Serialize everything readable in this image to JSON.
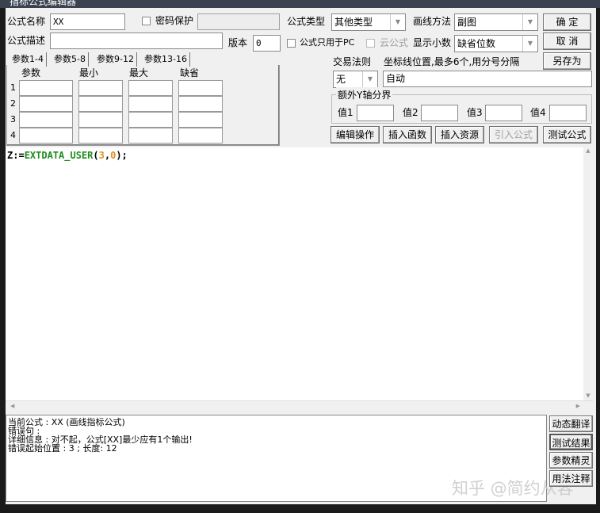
{
  "window": {
    "title": "指标公式编辑器"
  },
  "form": {
    "name_label": "公式名称",
    "name_value": "XX",
    "password_label": "密码保护",
    "desc_label": "公式描述",
    "desc_value": "",
    "version_label": "版本",
    "version_value": "0",
    "type_label": "公式类型",
    "type_value": "其他类型",
    "draw_label": "画线方法",
    "draw_value": "副图",
    "pc_only_label": "公式只用于PC",
    "cloud_label": "云公式",
    "decimal_label": "显示小数",
    "decimal_value": "缺省位数",
    "trade_label": "交易法则",
    "trade_value": "无",
    "axis_label": "坐标线位置,最多6个,用分号分隔",
    "axis_value": "自动",
    "yaxis_group": "额外Y轴分界",
    "yvals": [
      "值1",
      "值2",
      "值3",
      "值4"
    ]
  },
  "tabs": [
    "参数1-4",
    "参数5-8",
    "参数9-12",
    "参数13-16"
  ],
  "params": {
    "headers": [
      "参数",
      "最小",
      "最大",
      "缺省"
    ],
    "rows": [
      "1",
      "2",
      "3",
      "4"
    ]
  },
  "buttons": {
    "ok": "确  定",
    "cancel": "取  消",
    "save_as": "另存为",
    "edit": "编辑操作",
    "insert_func": "插入函数",
    "insert_res": "插入资源",
    "import": "引入公式",
    "test": "测试公式"
  },
  "code": {
    "var": "Z:=",
    "func": "EXTDATA_USER",
    "open": "(",
    "a1": "3",
    "comma": ",",
    "a2": "0",
    "close": ");"
  },
  "output": {
    "lines": [
      "当前公式 : XX (画线指标公式)",
      "错误句 :",
      "详细信息 : 对不起，公式[XX]最少应有1个输出!",
      "错误起始位置 : 3 ; 长度: 12"
    ]
  },
  "side_buttons": [
    "动态翻译",
    "测试结果",
    "参数精灵",
    "用法注释"
  ],
  "watermark": "知乎 @简约从容"
}
